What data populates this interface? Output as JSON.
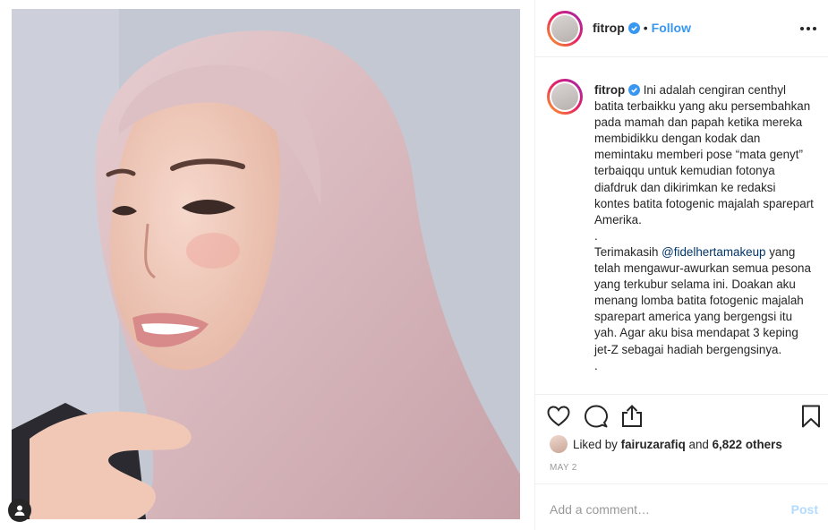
{
  "post": {
    "username": "fitrop",
    "follow_label": "Follow",
    "separator": "•",
    "caption_username": "fitrop",
    "caption_part1": "Ini adalah cengiran centhyl batita terbaikku yang aku persembahkan pada mamah dan papah ketika mereka membidikku dengan kodak dan memintaku memberi pose “mata genyt” terbaiqqu untuk kemudian fotonya diafdruk dan dikirimkan ke redaksi kontes batita fotogenic majalah sparepart Amerika.",
    "dot1": ".",
    "caption_part2_pre": "Terimakasih",
    "mention": "@fidelhertamakeup",
    "caption_part2_post": "yang telah mengawur-awurkan semua pesona yang terkubur selama ini. Doakan aku menang lomba batita fotogenic majalah sparepart america yang bergengsi itu yah. Agar aku bisa mendapat 3 keping jet-Z sebagai hadiah bergengsinya.",
    "dot2": ".",
    "likes_prefix": "Liked by",
    "liker": "fairuzarafiq",
    "likes_and": "and",
    "likes_count": "6,822 others",
    "date": "MAY 2",
    "comment_placeholder": "Add a comment…",
    "post_label": "Post"
  },
  "colors": {
    "follow": "#3897f0",
    "verified": "#3897f0",
    "post_disabled": "#b3dbff",
    "muted": "#999999"
  },
  "icons": [
    "verified-badge-icon",
    "more-options-icon",
    "heart-icon",
    "comment-icon",
    "share-icon",
    "bookmark-icon",
    "user-tag-icon"
  ]
}
